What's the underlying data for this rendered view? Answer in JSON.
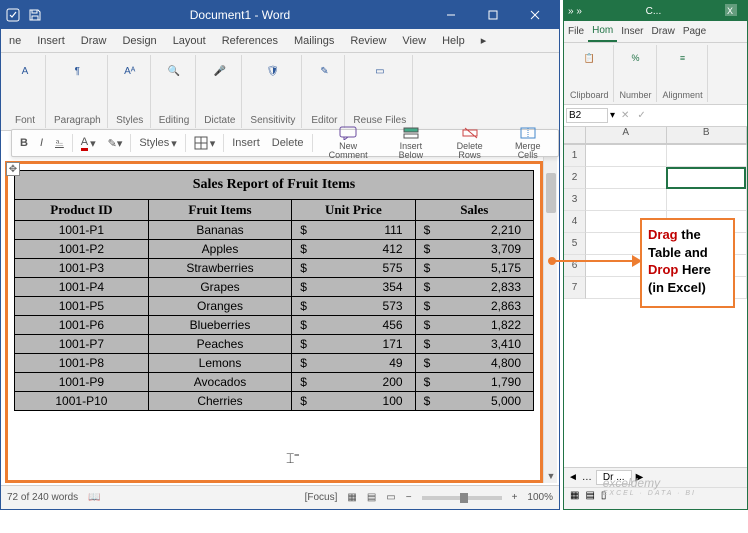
{
  "word": {
    "title": "Document1 - Word",
    "tabs": [
      "ne",
      "Insert",
      "Draw",
      "Design",
      "Layout",
      "References",
      "Mailings",
      "Review",
      "View",
      "Help"
    ],
    "ribbon_groups": [
      "Font",
      "Paragraph",
      "Styles",
      "Editing",
      "Dictate",
      "Sensitivity",
      "Editor",
      "Reuse Files"
    ],
    "mini_toolbar": {
      "bold": "B",
      "italic": "I",
      "insert": "Insert",
      "delete": "Delete",
      "new_comment": "New Comment",
      "insert_below": "Insert Below",
      "delete_rows": "Delete Rows",
      "merge_cells": "Merge Cells",
      "styles": "Styles"
    },
    "status": {
      "words": "72 of 240 words",
      "focus": "Focus",
      "zoom": "100%"
    }
  },
  "table": {
    "title": "Sales Report of Fruit Items",
    "headers": [
      "Product ID",
      "Fruit Items",
      "Unit Price",
      "Sales"
    ],
    "rows": [
      {
        "id": "1001-P1",
        "fruit": "Bananas",
        "price": "111",
        "sales": "2,210"
      },
      {
        "id": "1001-P2",
        "fruit": "Apples",
        "price": "412",
        "sales": "3,709"
      },
      {
        "id": "1001-P3",
        "fruit": "Strawberries",
        "price": "575",
        "sales": "5,175"
      },
      {
        "id": "1001-P4",
        "fruit": "Grapes",
        "price": "354",
        "sales": "2,833"
      },
      {
        "id": "1001-P5",
        "fruit": "Oranges",
        "price": "573",
        "sales": "2,863"
      },
      {
        "id": "1001-P6",
        "fruit": "Blueberries",
        "price": "456",
        "sales": "1,822"
      },
      {
        "id": "1001-P7",
        "fruit": "Peaches",
        "price": "171",
        "sales": "3,410"
      },
      {
        "id": "1001-P8",
        "fruit": "Lemons",
        "price": "49",
        "sales": "4,800"
      },
      {
        "id": "1001-P9",
        "fruit": "Avocados",
        "price": "200",
        "sales": "1,790"
      },
      {
        "id": "1001-P10",
        "fruit": "Cherries",
        "price": "100",
        "sales": "5,000"
      }
    ]
  },
  "excel": {
    "title": "C...",
    "tabs": [
      "File",
      "Hom",
      "Inser",
      "Draw",
      "Page"
    ],
    "ribbon": [
      "Clipboard",
      "Number",
      "Alignment"
    ],
    "namebox": "B2",
    "cols": [
      "A",
      "B"
    ],
    "rows": [
      "1",
      "2",
      "3",
      "4",
      "5",
      "6",
      "7"
    ],
    "sheet": "Dr ..."
  },
  "callout": {
    "l1a": "Drag",
    "l1b": " the",
    "l2": "Table and",
    "l3a": "Drop",
    "l3b": " Here",
    "l4": "(in Excel)"
  },
  "watermark": {
    "main": "exceldemy",
    "sub": "EXCEL · DATA · BI"
  }
}
